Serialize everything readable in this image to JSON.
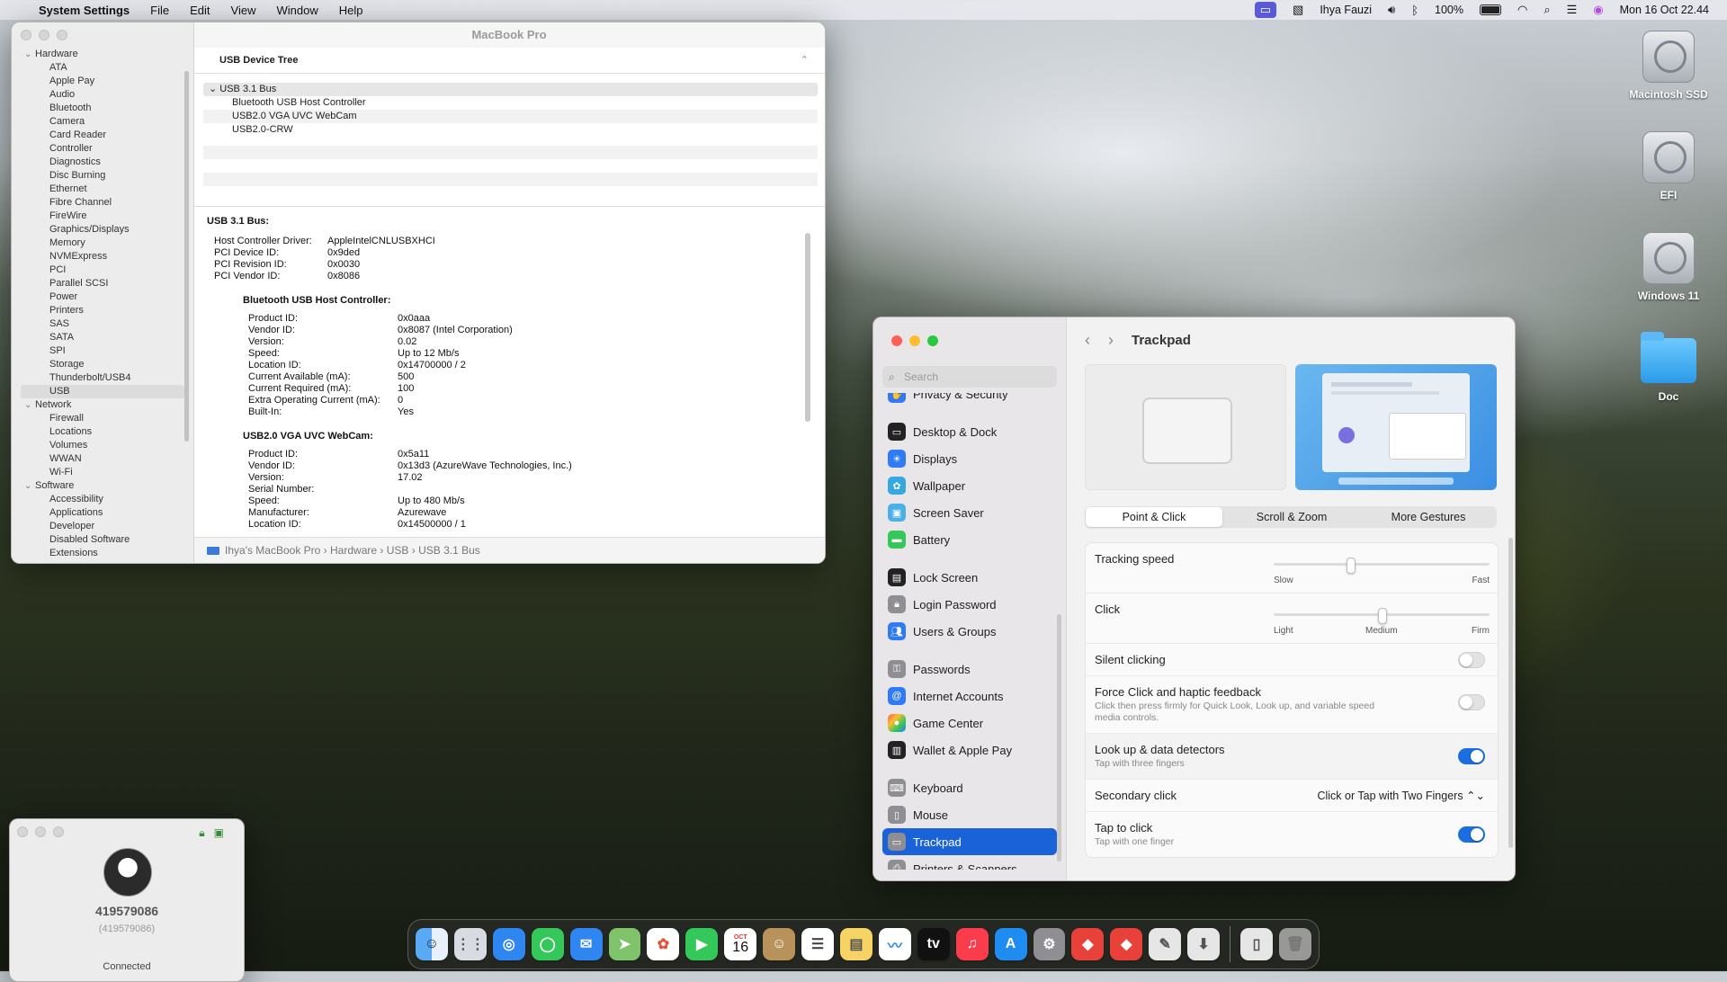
{
  "menubar": {
    "apple": "",
    "app_name": "System Settings",
    "menus": [
      "File",
      "Edit",
      "View",
      "Window",
      "Help"
    ],
    "user": "Ihya Fauzi",
    "battery_pct": "100%",
    "clock": "Mon 16 Oct  22.44"
  },
  "desktop": {
    "icons": [
      "Macintosh SSD",
      "EFI",
      "Windows 11",
      "Doc"
    ]
  },
  "sysinfo": {
    "title": "MacBook Pro",
    "sidebar": {
      "hardware": "Hardware",
      "hardware_items": [
        "ATA",
        "Apple Pay",
        "Audio",
        "Bluetooth",
        "Camera",
        "Card Reader",
        "Controller",
        "Diagnostics",
        "Disc Burning",
        "Ethernet",
        "Fibre Channel",
        "FireWire",
        "Graphics/Displays",
        "Memory",
        "NVMExpress",
        "PCI",
        "Parallel SCSI",
        "Power",
        "Printers",
        "SAS",
        "SATA",
        "SPI",
        "Storage",
        "Thunderbolt/USB4",
        "USB"
      ],
      "network": "Network",
      "network_items": [
        "Firewall",
        "Locations",
        "Volumes",
        "WWAN",
        "Wi-Fi"
      ],
      "software": "Software",
      "software_items": [
        "Accessibility",
        "Applications",
        "Developer",
        "Disabled Software",
        "Extensions"
      ]
    },
    "tree_header": "USB Device Tree",
    "tree": {
      "bus": "USB 3.1 Bus",
      "devices": [
        "Bluetooth USB Host Controller",
        "USB2.0 VGA UVC WebCam",
        "USB2.0-CRW"
      ]
    },
    "detail": {
      "heading": "USB 3.1 Bus:",
      "bus_kv": [
        [
          "Host Controller Driver:",
          "AppleIntelCNLUSBXHCI"
        ],
        [
          "PCI Device ID:",
          "0x9ded"
        ],
        [
          "PCI Revision ID:",
          "0x0030"
        ],
        [
          "PCI Vendor ID:",
          "0x8086"
        ]
      ],
      "bt_heading": "Bluetooth USB Host Controller:",
      "bt_kv": [
        [
          "Product ID:",
          "0x0aaa"
        ],
        [
          "Vendor ID:",
          "0x8087  (Intel Corporation)"
        ],
        [
          "Version:",
          "0.02"
        ],
        [
          "Speed:",
          "Up to 12 Mb/s"
        ],
        [
          "Location ID:",
          "0x14700000 / 2"
        ],
        [
          "Current Available (mA):",
          "500"
        ],
        [
          "Current Required (mA):",
          "100"
        ],
        [
          "Extra Operating Current (mA):",
          "0"
        ],
        [
          "Built-In:",
          "Yes"
        ]
      ],
      "cam_heading": "USB2.0 VGA UVC WebCam:",
      "cam_kv": [
        [
          "Product ID:",
          "0x5a11"
        ],
        [
          "Vendor ID:",
          "0x13d3  (AzureWave Technologies, Inc.)"
        ],
        [
          "Version:",
          "17.02"
        ],
        [
          "Serial Number:",
          ""
        ],
        [
          "Speed:",
          "Up to 480 Mb/s"
        ],
        [
          "Manufacturer:",
          "Azurewave"
        ],
        [
          "Location ID:",
          "0x14500000 / 1"
        ]
      ]
    },
    "path": [
      "Ihya's MacBook Pro",
      "Hardware",
      "USB",
      "USB 3.1 Bus"
    ]
  },
  "settings": {
    "search_placeholder": "Search",
    "nav": [
      "Privacy & Security",
      "Desktop & Dock",
      "Displays",
      "Wallpaper",
      "Screen Saver",
      "Battery",
      "Lock Screen",
      "Login Password",
      "Users & Groups",
      "Passwords",
      "Internet Accounts",
      "Game Center",
      "Wallet & Apple Pay",
      "Keyboard",
      "Mouse",
      "Trackpad",
      "Printers & Scanners"
    ],
    "page_title": "Trackpad",
    "tabs": [
      "Point & Click",
      "Scroll & Zoom",
      "More Gestures"
    ],
    "tracking_speed": {
      "label": "Tracking speed",
      "min": "Slow",
      "max": "Fast",
      "value": 0.35
    },
    "click": {
      "label": "Click",
      "ticks": [
        "Light",
        "Medium",
        "Firm"
      ],
      "value": 0.5
    },
    "silent_clicking": {
      "label": "Silent clicking",
      "on": false
    },
    "force_click": {
      "label": "Force Click and haptic feedback",
      "sub": "Click then press firmly for Quick Look, Look up, and variable speed media controls.",
      "on": false
    },
    "lookup": {
      "label": "Look up & data detectors",
      "sub": "Tap with three fingers",
      "on": true
    },
    "secondary_click": {
      "label": "Secondary click",
      "value": "Click or Tap with Two Fingers ⌃⌄"
    },
    "tap_to_click": {
      "label": "Tap to click",
      "sub": "Tap with one finger",
      "on": true
    }
  },
  "remote": {
    "id": "419579086",
    "id_paren": "(419579086)",
    "status": "Connected"
  },
  "dock": {
    "date_month": "OCT",
    "date_day": "16"
  }
}
